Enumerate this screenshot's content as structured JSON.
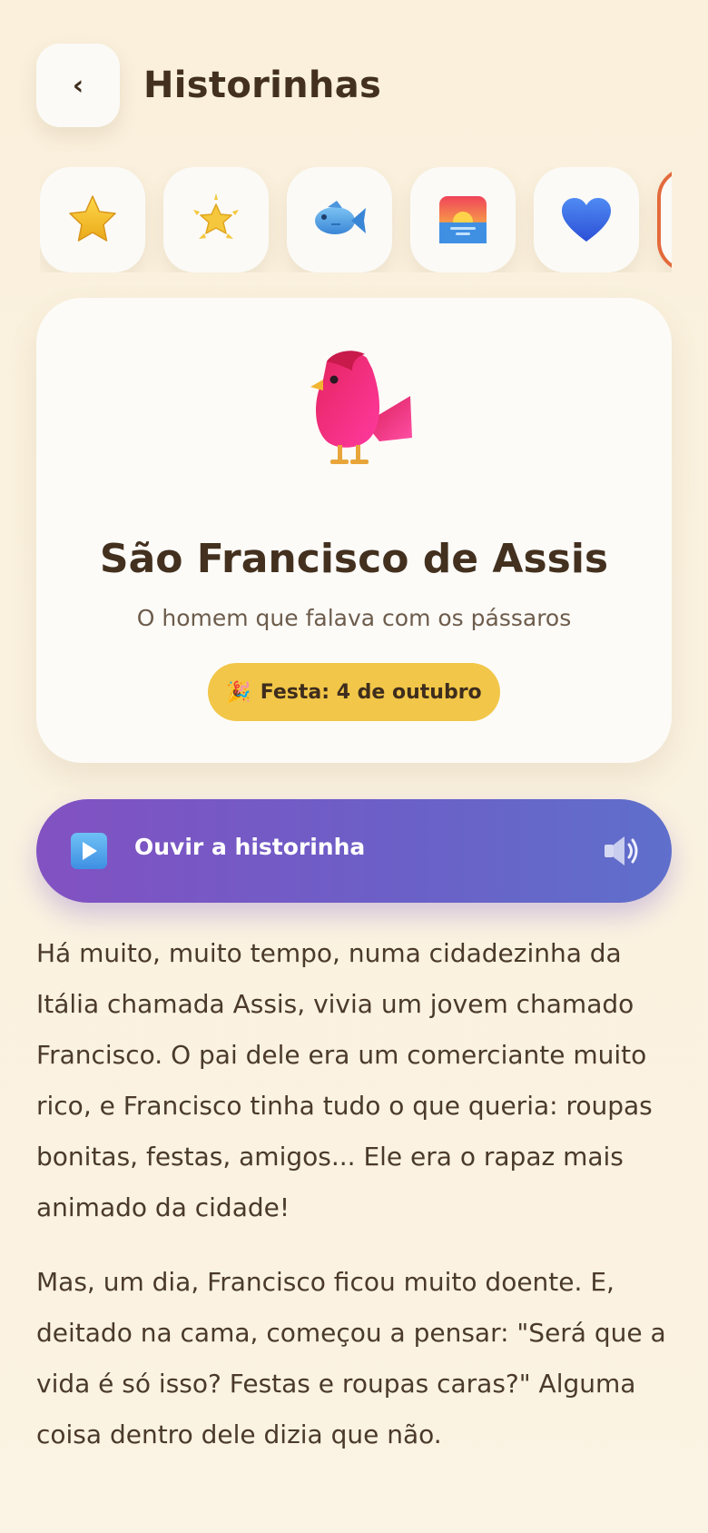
{
  "header": {
    "back_label": "‹",
    "title": "Historinhas"
  },
  "categories": [
    {
      "icon": "star-icon"
    },
    {
      "icon": "sparkle-star-icon"
    },
    {
      "icon": "fish-icon"
    },
    {
      "icon": "sunrise-icon"
    },
    {
      "icon": "heart-icon"
    },
    {
      "icon": "more-category-icon"
    }
  ],
  "hero": {
    "icon": "bird-icon",
    "title": "São Francisco de Assis",
    "subtitle": "O homem que falava com os pássaros",
    "feast_emoji": "🎉",
    "feast_label": "Festa: 4 de outubro"
  },
  "listen": {
    "label": "Ouvir a historinha"
  },
  "story": {
    "paragraphs": [
      "Há muito, muito tempo, numa cidadezinha da Itália chamada Assis, vivia um jovem chamado Francisco. O pai dele era um comerciante muito rico, e Francisco tinha tudo o que queria: roupas bonitas, festas, amigos... Ele era o rapaz mais animado da cidade!",
      "Mas, um dia, Francisco ficou muito doente. E, deitado na cama, começou a pensar: \"Será que a vida é só isso? Festas e roupas caras?\" Alguma coisa dentro dele dizia que não."
    ]
  },
  "colors": {
    "background": "#fbf1df",
    "badge": "#f2c648",
    "listen_start": "#8251c2",
    "listen_end": "#5f6fcb"
  }
}
